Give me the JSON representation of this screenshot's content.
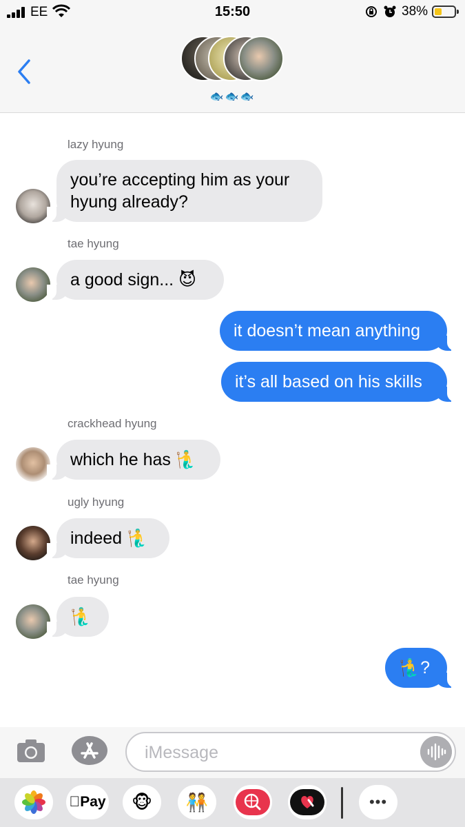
{
  "status_bar": {
    "carrier": "EE",
    "time": "15:50",
    "battery_percent": "38%",
    "battery_level": 0.38
  },
  "header": {
    "group_emoji": "🐟🐟🐟"
  },
  "conversation": {
    "lazy_sender": "lazy hyung",
    "msg_accepting": "you’re accepting him as your hyung already?",
    "tae_sender_1": "tae hyung",
    "msg_good_sign": "a good sign... 😈",
    "msg_doesnt_mean": "it doesn’t mean anything",
    "msg_skills": "it’s all based on his skills",
    "crackhead_sender": "crackhead hyung",
    "msg_which_he_has": "which he has 🧜‍♂️",
    "ugly_sender": "ugly hyung",
    "msg_indeed": "indeed 🧜‍♂️",
    "tae_sender_2": "tae hyung",
    "msg_merman": "🧜‍♂️",
    "msg_merman_question": "🧜‍♂️?"
  },
  "composer": {
    "placeholder": "iMessage"
  },
  "app_drawer": {
    "apple_pay_label": "Pay",
    "monkey_glyph": "🐵",
    "memoji_glyph": "🧑‍🤝‍🧑",
    "more_glyph": "•••"
  },
  "colors": {
    "accent_blue": "#2b7ef2",
    "incoming_bubble": "#e9e9eb",
    "header_bg": "#f6f6f6"
  }
}
